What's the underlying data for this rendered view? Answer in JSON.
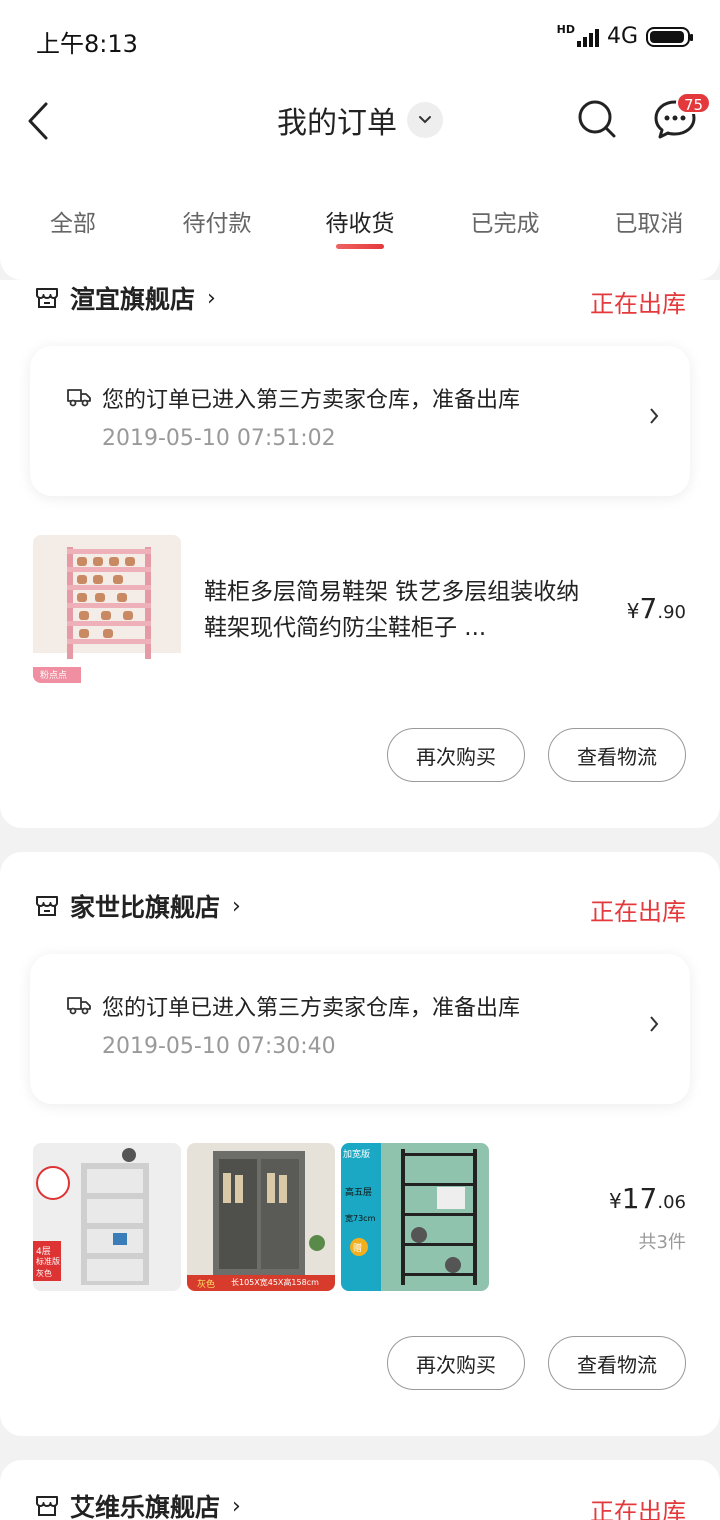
{
  "status_bar": {
    "time": "上午8:13",
    "network": "4G",
    "hd": "HD"
  },
  "header": {
    "title": "我的订单",
    "message_count": "75"
  },
  "tabs": [
    {
      "label": "全部"
    },
    {
      "label": "待付款"
    },
    {
      "label": "待收货"
    },
    {
      "label": "已完成"
    },
    {
      "label": "已取消"
    }
  ],
  "active_tab": "待收货",
  "orders": [
    {
      "shop": "渲宜旗舰店",
      "status": "正在出库",
      "logistics": {
        "text": "您的订单已进入第三方卖家仓库，准备出库",
        "time": "2019-05-10 07:51:02"
      },
      "product": {
        "title": "鞋柜多层简易鞋架 铁艺多层组装收纳鞋架现代简约防尘鞋柜子 ...",
        "price_symbol": "¥",
        "price_int": "7",
        "price_dec": ".90",
        "thumb_label": "粉点点"
      },
      "actions": {
        "rebuy": "再次购买",
        "track": "查看物流"
      }
    },
    {
      "shop": "家世比旗舰店",
      "status": "正在出库",
      "logistics": {
        "text": "您的订单已进入第三方卖家仓库，准备出库",
        "time": "2019-05-10 07:30:40"
      },
      "product": {
        "price_symbol": "¥",
        "price_int": "17",
        "price_dec": ".06",
        "quantity": "共3件",
        "thumb_labels": [
          "4层",
          "标准版",
          "灰色",
          "灰色",
          "长105X宽45X高158cm",
          "加宽版",
          "高五层",
          "宽73cm",
          "赠"
        ]
      },
      "actions": {
        "rebuy": "再次购买",
        "track": "查看物流"
      }
    },
    {
      "shop": "艾维乐旗舰店",
      "status": "正在出库"
    }
  ],
  "colors": {
    "accent": "#e4393c",
    "background": "#f2f2f2"
  }
}
